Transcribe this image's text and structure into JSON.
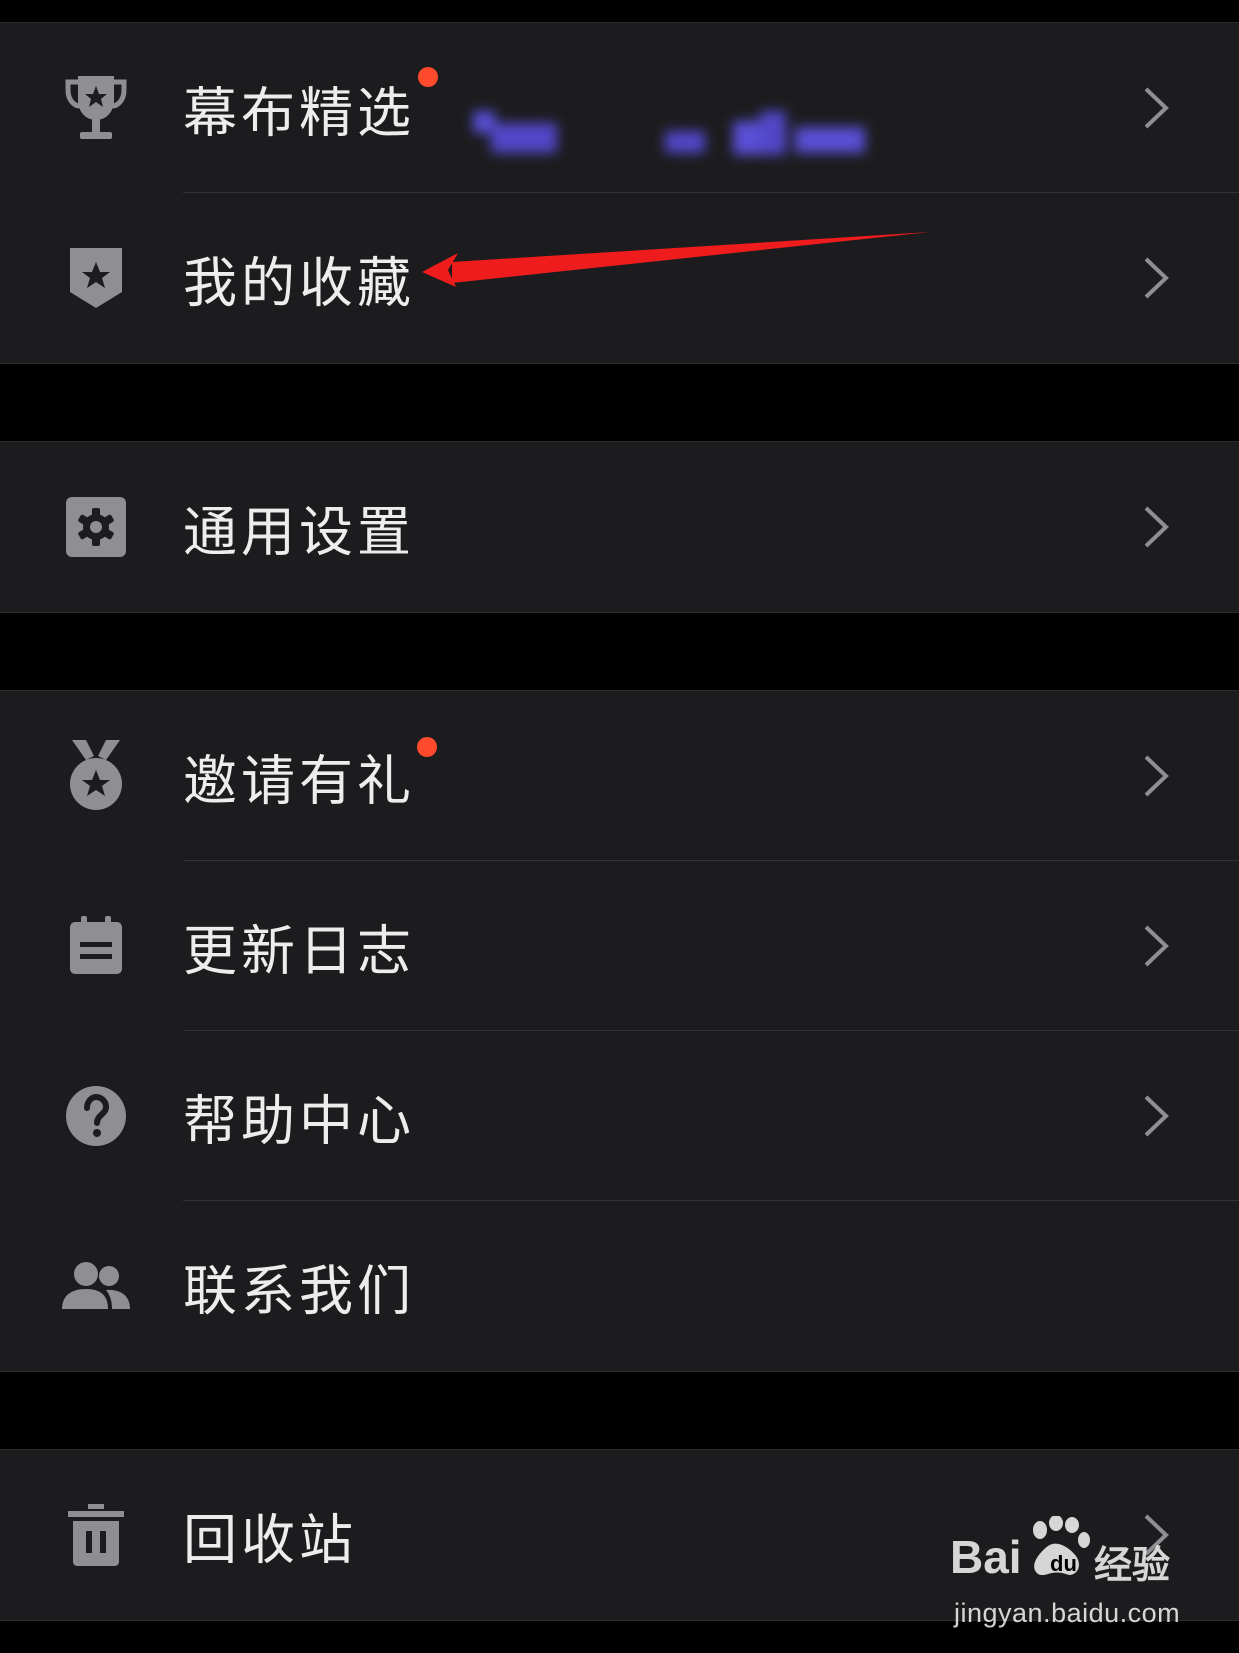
{
  "groups": [
    {
      "items": [
        {
          "label": "幕布精选",
          "icon": "trophy-icon",
          "badge": true,
          "chevron": true
        },
        {
          "label": "我的收藏",
          "icon": "bookmark-star-icon",
          "badge": false,
          "chevron": true
        }
      ]
    },
    {
      "items": [
        {
          "label": "通用设置",
          "icon": "gear-icon",
          "badge": false,
          "chevron": true
        }
      ]
    },
    {
      "items": [
        {
          "label": "邀请有礼",
          "icon": "medal-icon",
          "badge": true,
          "chevron": true
        },
        {
          "label": "更新日志",
          "icon": "notepad-icon",
          "badge": false,
          "chevron": true
        },
        {
          "label": "帮助中心",
          "icon": "question-circle-icon",
          "badge": false,
          "chevron": true
        },
        {
          "label": "联系我们",
          "icon": "users-icon",
          "badge": false,
          "chevron": false
        }
      ]
    },
    {
      "items": [
        {
          "label": "回收站",
          "icon": "trash-icon",
          "badge": false,
          "chevron": true
        }
      ]
    }
  ],
  "colors": {
    "background": "#000000",
    "group_background": "#1c1c1e",
    "text": "#ededed",
    "icon": "#8e8e93",
    "badge": "#ff4a2e",
    "annotation_arrow": "#ee1c1c"
  },
  "watermark": {
    "brand": "Bai",
    "product": "经验",
    "url": "jingyan.baidu.com"
  }
}
